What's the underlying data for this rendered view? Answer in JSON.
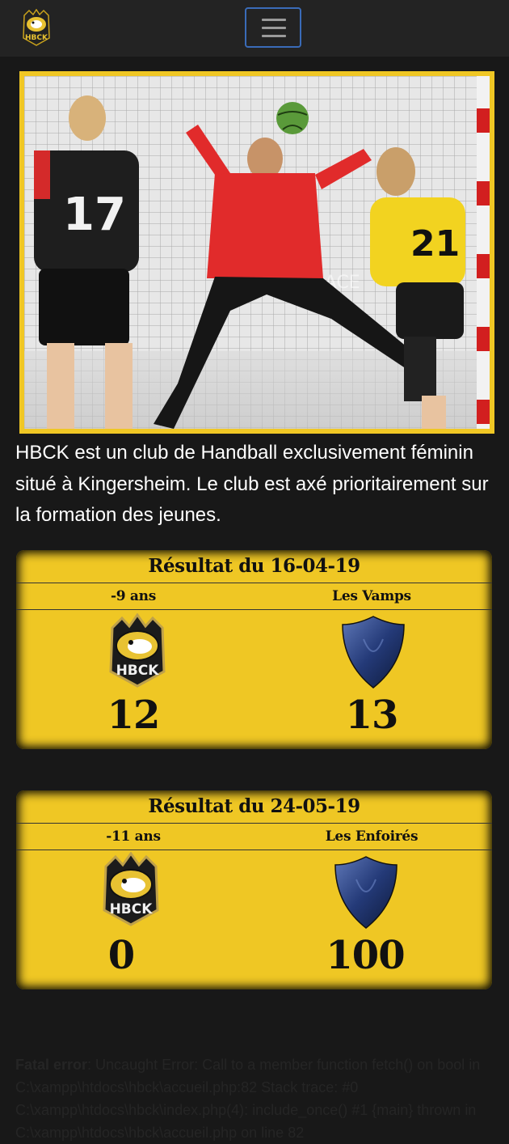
{
  "navbar": {
    "logo_text": "HBCK",
    "toggle_label": ""
  },
  "intro": "HBCK est un club de Handball exclusivement féminin situé à Kingersheim. Le club est axé prioritairement sur la formation des jeunes.",
  "hero": {
    "watermark": "ALSACE",
    "jerseys": [
      "17",
      "21"
    ]
  },
  "results": [
    {
      "title": "Résultat du 16-04-19",
      "home_team": "-9 ans",
      "away_team": "Les Vamps",
      "home_score": "12",
      "away_score": "13"
    },
    {
      "title": "Résultat du 24-05-19",
      "home_team": "-11 ans",
      "away_team": "Les Enfoirés",
      "home_score": "0",
      "away_score": "100"
    }
  ],
  "error": {
    "label": "Fatal error",
    "message": ": Uncaught Error: Call to a member function fetch() on bool in C:\\xampp\\htdocs\\hbck\\accueil.php:82 Stack trace: #0 C:\\xampp\\htdocs\\hbck\\index.php(4): include_once() #1 {main} thrown in C:\\xampp\\htdocs\\hbck\\accueil.php on line 82"
  },
  "colors": {
    "accent": "#efc724",
    "background": "#181818",
    "navbar": "#232323"
  }
}
